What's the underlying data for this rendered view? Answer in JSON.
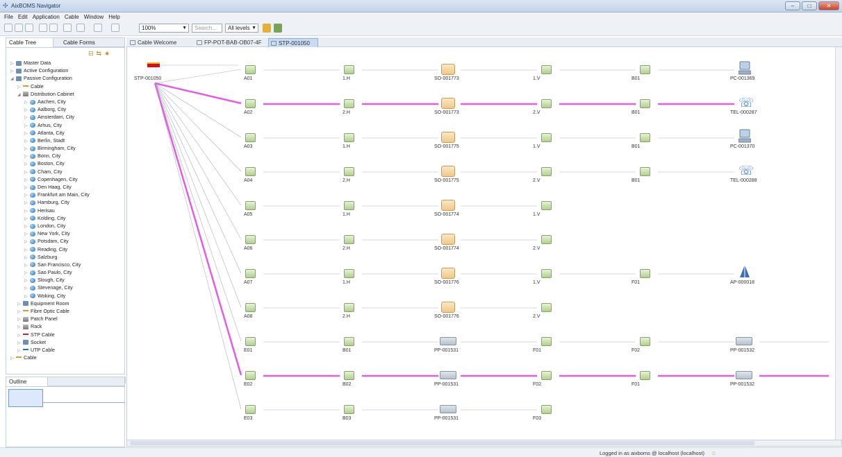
{
  "window": {
    "title": "AixBOMS Navigator",
    "min_btn": "–",
    "max_btn": "□",
    "close_btn": "✕"
  },
  "menu": [
    "File",
    "Edit",
    "Application",
    "Cable",
    "Window",
    "Help"
  ],
  "toolbar": {
    "zoom": "100%",
    "search_placeholder": "Search...",
    "levels": "All levels"
  },
  "left_tabs": {
    "tree": "Cable Tree",
    "forms": "Cable Forms"
  },
  "tree": [
    {
      "label": "Master Data",
      "level": 0,
      "icon": "sq"
    },
    {
      "label": "Active Configuration",
      "level": 0,
      "icon": "sq"
    },
    {
      "label": "Passive Configuration",
      "level": 0,
      "icon": "sq"
    },
    {
      "label": "Cable",
      "level": 1,
      "icon": "line"
    },
    {
      "label": "Distribution Cabinet",
      "level": 1,
      "icon": "cab"
    },
    {
      "label": "Aachen, City",
      "level": 2,
      "icon": "globe"
    },
    {
      "label": "Aalborg, City",
      "level": 2,
      "icon": "globe"
    },
    {
      "label": "Amsterdam, City",
      "level": 2,
      "icon": "globe"
    },
    {
      "label": "Arhus, City",
      "level": 2,
      "icon": "globe"
    },
    {
      "label": "Atlanta, City",
      "level": 2,
      "icon": "globe"
    },
    {
      "label": "Berlin, Stadt",
      "level": 2,
      "icon": "globe"
    },
    {
      "label": "Birmingham, City",
      "level": 2,
      "icon": "globe"
    },
    {
      "label": "Bonn, City",
      "level": 2,
      "icon": "globe"
    },
    {
      "label": "Boston, City",
      "level": 2,
      "icon": "globe"
    },
    {
      "label": "Cham, City",
      "level": 2,
      "icon": "globe"
    },
    {
      "label": "Copenhagen, City",
      "level": 2,
      "icon": "globe"
    },
    {
      "label": "Den Haag, City",
      "level": 2,
      "icon": "globe"
    },
    {
      "label": "Frankfurt am Main, City",
      "level": 2,
      "icon": "globe"
    },
    {
      "label": "Hamburg, City",
      "level": 2,
      "icon": "globe"
    },
    {
      "label": "Herisau",
      "level": 2,
      "icon": "globe"
    },
    {
      "label": "Kolding, City",
      "level": 2,
      "icon": "globe"
    },
    {
      "label": "London, City",
      "level": 2,
      "icon": "globe"
    },
    {
      "label": "New York, City",
      "level": 2,
      "icon": "globe"
    },
    {
      "label": "Potsdam, City",
      "level": 2,
      "icon": "globe"
    },
    {
      "label": "Reading, City",
      "level": 2,
      "icon": "globe"
    },
    {
      "label": "Salzburg",
      "level": 2,
      "icon": "globe"
    },
    {
      "label": "San Francisco, City",
      "level": 2,
      "icon": "globe"
    },
    {
      "label": "Sao Paulo, City",
      "level": 2,
      "icon": "globe"
    },
    {
      "label": "Slough, City",
      "level": 2,
      "icon": "globe"
    },
    {
      "label": "Stevenage, City",
      "level": 2,
      "icon": "globe"
    },
    {
      "label": "Woking, City",
      "level": 2,
      "icon": "globe"
    },
    {
      "label": "Equipment Room",
      "level": 1,
      "icon": "sq"
    },
    {
      "label": "Fibre Optic Cable",
      "level": 1,
      "icon": "line"
    },
    {
      "label": "Patch Panel",
      "level": 1,
      "icon": "cab"
    },
    {
      "label": "Rack",
      "level": 1,
      "icon": "cab"
    },
    {
      "label": "STP Cable",
      "level": 1,
      "icon": "red"
    },
    {
      "label": "Socket",
      "level": 1,
      "icon": "sq"
    },
    {
      "label": "UTP Cable",
      "level": 1,
      "icon": "blue"
    },
    {
      "label": "Cable",
      "level": 0,
      "icon": "line"
    }
  ],
  "outline_tab": "Outline",
  "editor_tabs": [
    "Cable Welcome Page",
    "FP-POT-BAB-OB07-4F",
    "STP-001050"
  ],
  "diagram": {
    "root": "STP-001050",
    "rows": [
      {
        "c1": "A01",
        "c2": "1.H",
        "c3": "SO-001773",
        "c3t": "socket",
        "c4": "1.V",
        "c5": "B01",
        "c6": "PC-001369",
        "c6t": "pc",
        "hl": false
      },
      {
        "c1": "A02",
        "c2": "2.H",
        "c3": "SO-001773",
        "c3t": "socket",
        "c4": "2.V",
        "c5": "B01",
        "c6": "TEL-000287",
        "c6t": "phone",
        "hl": true
      },
      {
        "c1": "A03",
        "c2": "1.H",
        "c3": "SO-001775",
        "c3t": "socket",
        "c4": "1.V",
        "c5": "B01",
        "c6": "PC-001370",
        "c6t": "pc",
        "hl": false
      },
      {
        "c1": "A04",
        "c2": "2.H",
        "c3": "SO-001775",
        "c3t": "socket",
        "c4": "2.V",
        "c5": "B01",
        "c6": "TEL-000288",
        "c6t": "phone",
        "hl": false
      },
      {
        "c1": "A05",
        "c2": "1.H",
        "c3": "SO-001774",
        "c3t": "socket",
        "c4": "1.V",
        "c5": "",
        "c6": "",
        "c6t": "",
        "hl": false
      },
      {
        "c1": "A06",
        "c2": "2.H",
        "c3": "SO-001774",
        "c3t": "socket",
        "c4": "2.V",
        "c5": "",
        "c6": "",
        "c6t": "",
        "hl": false
      },
      {
        "c1": "A07",
        "c2": "1.H",
        "c3": "SO-001776",
        "c3t": "socket",
        "c4": "1.V",
        "c5": "F01",
        "c6": "AP-000018",
        "c6t": "ap",
        "hl": false
      },
      {
        "c1": "A08",
        "c2": "2.H",
        "c3": "SO-001776",
        "c3t": "socket",
        "c4": "2.V",
        "c5": "",
        "c6": "",
        "c6t": "",
        "hl": false
      },
      {
        "c1": "E01",
        "c2": "B01",
        "c3": "PP-001531",
        "c3t": "patch",
        "c4": "F01",
        "c5": "F02",
        "c6": "PP-001532",
        "c6t": "patch",
        "hl": false
      },
      {
        "c1": "E02",
        "c2": "B02",
        "c3": "PP-001531",
        "c3t": "patch",
        "c4": "F02",
        "c5": "F01",
        "c6": "PP-001532",
        "c6t": "patch",
        "hl": true
      },
      {
        "c1": "E03",
        "c2": "B03",
        "c3": "PP-001531",
        "c3t": "patch",
        "c4": "F03",
        "c5": "",
        "c6": "",
        "c6t": "",
        "hl": false
      }
    ]
  },
  "status": {
    "text": "Logged in as aixboms @ localhost (localhost)"
  },
  "colors": {
    "highlight": "#e45be4",
    "thin": "#a8b0bb"
  }
}
